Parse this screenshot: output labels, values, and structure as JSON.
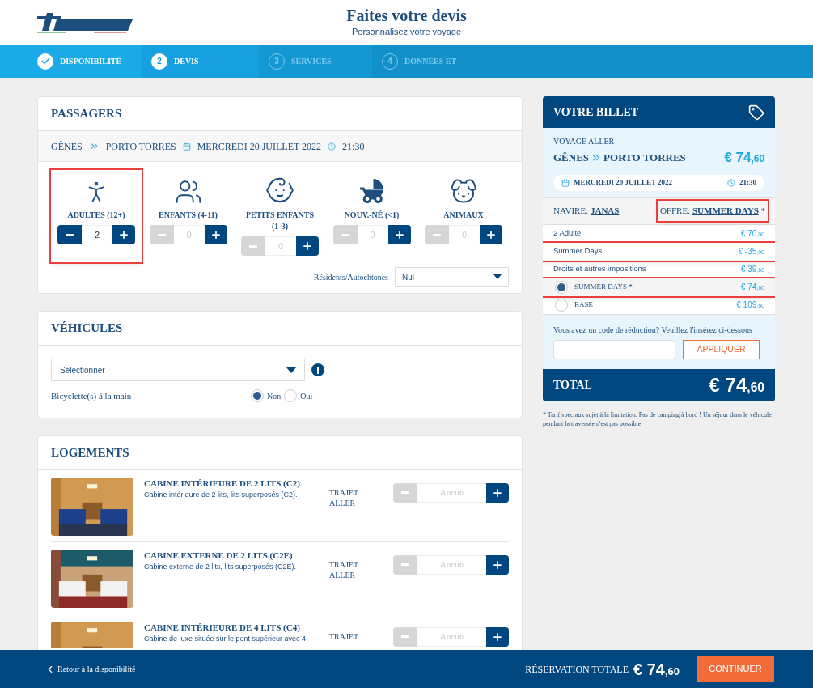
{
  "header": {
    "title": "Faites votre devis",
    "subtitle": "Personnalisez votre voyage"
  },
  "steps": [
    {
      "kind": "done",
      "label": "DISPONIBILITÉ"
    },
    {
      "kind": "current",
      "number": "2",
      "label": "DEVIS"
    },
    {
      "kind": "upcoming",
      "number": "3",
      "label": "SERVICES"
    },
    {
      "kind": "upcoming",
      "number": "4",
      "label": "DONNÉES ET"
    }
  ],
  "passengers": {
    "title": "PASSAGERS",
    "from": "GÊNES",
    "to": "PORTO TORRES",
    "date": "MERCREDI 20 JUILLET 2022",
    "time": "21:30",
    "types": [
      {
        "kind": "adult",
        "label": "ADULTES (12+)",
        "value": "2",
        "minus_enabled": true,
        "highlighted": true
      },
      {
        "kind": "child",
        "label": "ENFANTS (4-11)",
        "value": "0",
        "minus_enabled": false,
        "highlighted": false
      },
      {
        "kind": "baby",
        "label": "PETITS ENFANTS (1-3)",
        "value": "0",
        "minus_enabled": false,
        "highlighted": false
      },
      {
        "kind": "newborn",
        "label": "NOUV.-NÉ (<1)",
        "value": "0",
        "minus_enabled": false,
        "highlighted": false
      },
      {
        "kind": "pet",
        "label": "ANIMAUX",
        "value": "0",
        "minus_enabled": false,
        "highlighted": false
      }
    ],
    "residents_label": "Résidents/Autochtones",
    "residents_value": "Nul"
  },
  "vehicles": {
    "title": "VÉHICULES",
    "select_value": "Sélectionner",
    "bicycle_label": "Bicyclette(s) á la main",
    "options": [
      {
        "label": "Non",
        "selected": true
      },
      {
        "label": "Oui",
        "selected": false
      }
    ]
  },
  "lodging": {
    "title": "LOGEMENTS",
    "rows": [
      {
        "name": "CABINE INTÉRIEURE DE 2 LITS (C2)",
        "description": "Cabine intérieure de 2 lits, lits superposés (C2).",
        "trajet": "TRAJET ALLER",
        "placeholder": "Aucun"
      },
      {
        "name": "CABINE EXTERNE DE 2 LITS (C2E)",
        "description": "Cabine externe de 2 lits, lits superposés (C2E).",
        "trajet": "TRAJET ALLER",
        "placeholder": "Aucun"
      },
      {
        "name": "CABINE INTÉRIEURE DE 4 LITS (C4)",
        "description": "Cabine de luxe située sur le pont supérieur avec 4",
        "trajet": "TRAJET",
        "placeholder": "Aucun"
      }
    ]
  },
  "ticket": {
    "title": "VOTRE BILLET",
    "trip_label": "VOYAGE ALLER",
    "from": "GÊNES",
    "to": "PORTO TORRES",
    "price": {
      "main": "€ 74",
      "cents": ",60"
    },
    "date": "MERCREDI 20 JUILLET 2022",
    "time": "21:30",
    "ship_label": "NAVIRE:",
    "ship": "JANAS",
    "offer_label": "OFFRE:",
    "offer": "SUMMER DAYS",
    "offer_mark": "*",
    "offer_highlighted": true,
    "lines": [
      {
        "label": "2 Adulte",
        "main": "€ 70",
        "cents": ",00",
        "highlighted": false
      },
      {
        "label": "Summer Days",
        "main": "€ -35",
        "cents": ",00",
        "highlighted": true
      },
      {
        "label": "Droits et autres impositions",
        "main": "€ 39",
        "cents": ",60",
        "highlighted": false
      }
    ],
    "fares": [
      {
        "label": "SUMMER DAYS *",
        "main": "€ 74",
        "cents": ",60",
        "selected": true,
        "highlighted": true
      },
      {
        "label": "BASE",
        "main": "€ 109",
        "cents": ",60",
        "selected": false,
        "highlighted": false
      }
    ],
    "promo_text": "Vous avez un code de réduction? Veuillez l'insérez ci-dessous",
    "apply": "APPLIQUER",
    "total_label": "TOTAL",
    "total": {
      "main": "€ 74",
      "cents": ",60"
    },
    "footnote": "* Tarif speciaux sujet à la limitation. Pas de camping à bord ! Un séjour dans le véhicule pendant la traversée n'est pas possible"
  },
  "bottom_bar": {
    "back": "Retour à la disponibilité",
    "total_label": "RÉSERVATION TOTALE",
    "total": {
      "main": "€ 74",
      "cents": ",60"
    },
    "continue": "CONTINUER"
  }
}
